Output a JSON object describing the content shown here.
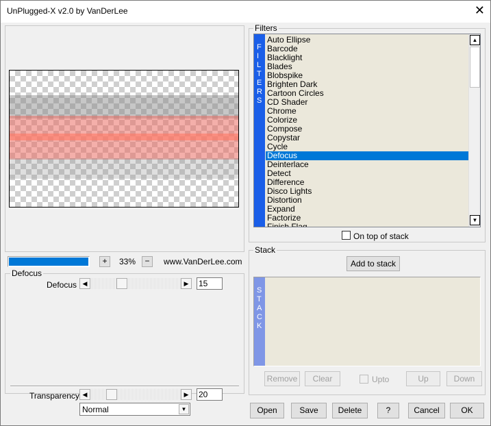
{
  "window": {
    "title": "UnPlugged-X v2.0 by VanDerLee"
  },
  "preview": {
    "zoom_plus": "+",
    "zoom_value": "33%",
    "zoom_minus": "−",
    "website": "www.VanDerLee.com",
    "progress": 1.0,
    "accent_color": "#0078d7"
  },
  "filter_group": {
    "title": "Defocus",
    "param_label": "Defocus",
    "param_value": "15",
    "param_slider_level": 0.33
  },
  "transparency": {
    "label": "Transparency",
    "value": "20",
    "slider_level": 0.2,
    "blend_mode": "Normal"
  },
  "filters": {
    "title": "Filters",
    "vertical_label": [
      "F",
      "I",
      "L",
      "T",
      "E",
      "R",
      "S"
    ],
    "items": [
      "Auto Ellipse",
      "Barcode",
      "Blacklight",
      "Blades",
      "Blobspike",
      "Brighten Dark",
      "Cartoon Circles",
      "CD Shader",
      "Chrome",
      "Colorize",
      "Compose",
      "Copystar",
      "Cycle",
      "Defocus",
      "Deinterlace",
      "Detect",
      "Difference",
      "Disco Lights",
      "Distortion",
      "Expand",
      "Factorize",
      "Finish Flag"
    ],
    "selected": "Defocus",
    "on_top_label": "On top of stack"
  },
  "stack": {
    "title": "Stack",
    "add_button": "Add to stack",
    "vertical_label": [
      "S",
      "T",
      "A",
      "C",
      "K"
    ],
    "remove": "Remove",
    "clear": "Clear",
    "upto": "Upto",
    "up": "Up",
    "down": "Down"
  },
  "buttons": {
    "open": "Open",
    "save": "Save",
    "delete": "Delete",
    "help": "?",
    "cancel": "Cancel",
    "ok": "OK"
  },
  "icons": {
    "close": "close-icon",
    "scroll_up": "scroll-up-icon",
    "scroll_down": "scroll-down-icon",
    "slider_left": "arrow-left-icon",
    "slider_right": "arrow-right-icon",
    "dropdown": "chevron-down-icon"
  }
}
